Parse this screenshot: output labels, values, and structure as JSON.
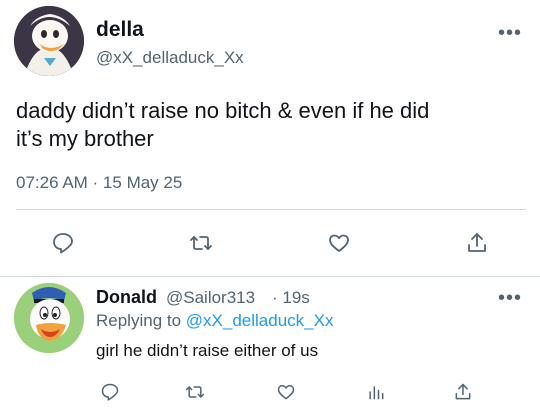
{
  "main_tweet": {
    "display_name": "della",
    "handle": "@xX_delladuck_Xx",
    "more_label": "•••",
    "text_line1": "daddy didn’t raise no bitch & even if he did",
    "text_line2": "it’s my brother",
    "timestamp": "07:26 AM · 15 May 25",
    "actions": [
      "reply-icon",
      "retweet-icon",
      "like-icon",
      "share-icon"
    ]
  },
  "reply_tweet": {
    "display_name": "Donald",
    "handle": "@Sailor313",
    "time": "· 19s",
    "more_label": "•••",
    "replying_prefix": "Replying to",
    "replying_handle": "@xX_delladuck_Xx",
    "text": "girl he didn’t raise either of us",
    "actions": [
      "reply-icon",
      "retweet-icon",
      "like-icon",
      "analytics-icon",
      "share-icon"
    ]
  },
  "colors": {
    "accent": "#1d9bf0",
    "secondary_text": "#536471",
    "divider": "#cfd9de"
  }
}
